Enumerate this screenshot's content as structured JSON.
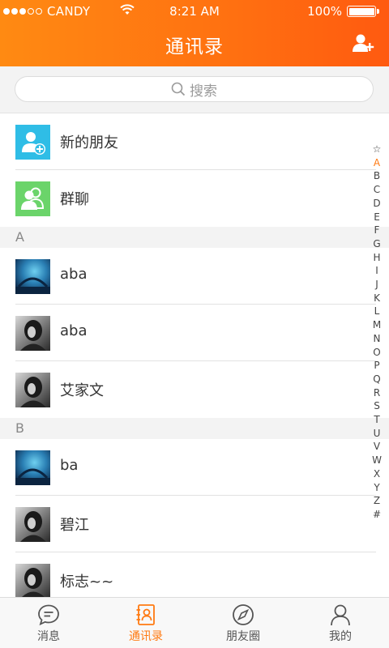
{
  "status_bar": {
    "carrier": "CANDY",
    "time": "8:21 AM",
    "battery": "100%"
  },
  "header": {
    "title": "通讯录"
  },
  "search": {
    "placeholder": "搜索"
  },
  "fixed_items": [
    {
      "label": "新的朋友",
      "icon": "new-friend-icon",
      "color": "#2fbde6"
    },
    {
      "label": "群聊",
      "icon": "group-chat-icon",
      "color": "#6bd46a"
    }
  ],
  "sections": [
    {
      "letter": "A",
      "contacts": [
        "aba",
        "aba",
        "艾家文"
      ]
    },
    {
      "letter": "B",
      "contacts": [
        "ba",
        "碧江",
        "标志~~"
      ]
    }
  ],
  "index": [
    "☆",
    "A",
    "B",
    "C",
    "D",
    "E",
    "F",
    "G",
    "H",
    "I",
    "J",
    "K",
    "L",
    "M",
    "N",
    "O",
    "P",
    "Q",
    "R",
    "S",
    "T",
    "U",
    "V",
    "W",
    "X",
    "Y",
    "Z",
    "#"
  ],
  "active_index": "A",
  "tabs": [
    {
      "label": "消息",
      "icon": "message-icon"
    },
    {
      "label": "通讯录",
      "icon": "contacts-icon",
      "active": true
    },
    {
      "label": "朋友圈",
      "icon": "compass-icon"
    },
    {
      "label": "我的",
      "icon": "profile-icon"
    }
  ],
  "colors": {
    "accent": "#ff7a12",
    "header_start": "#ff8a12",
    "header_end": "#ff5a10"
  }
}
